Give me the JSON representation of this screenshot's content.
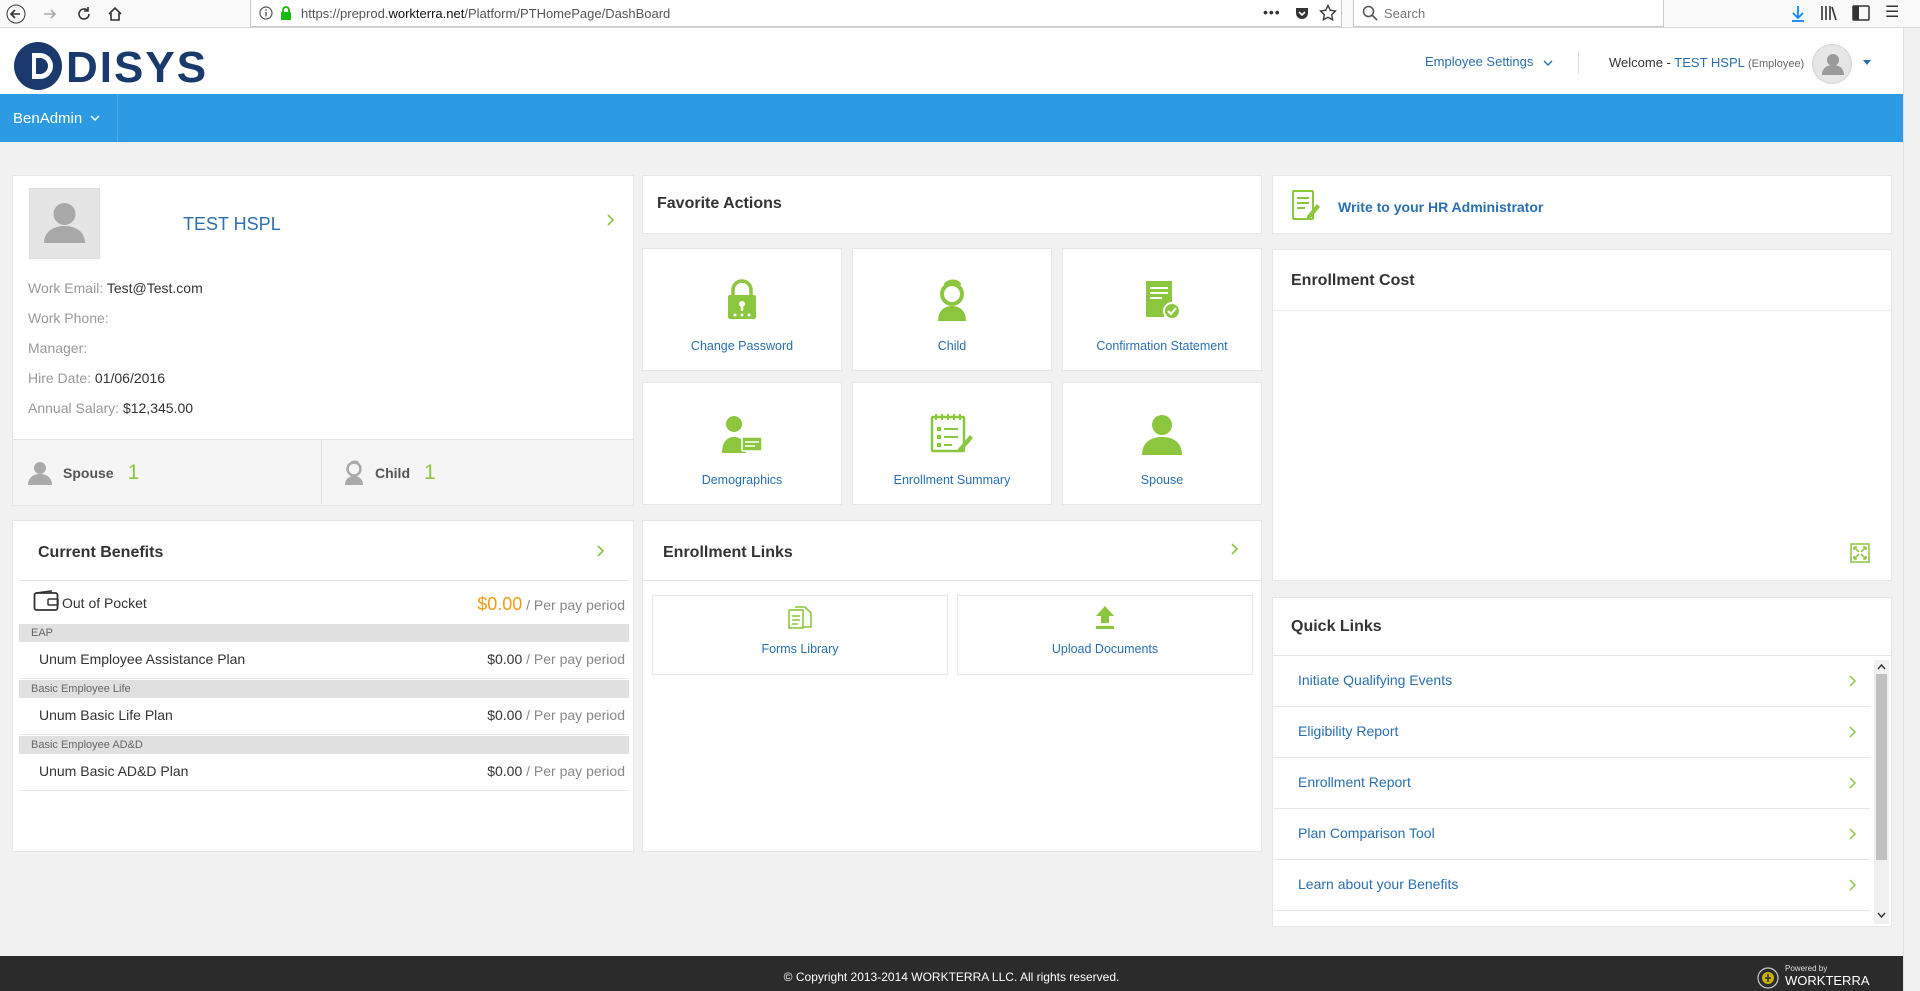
{
  "browser": {
    "url_prefix": "https://preprod.",
    "url_domain": "workterra.net",
    "url_path": "/Platform/PTHomePage/DashBoard",
    "search_placeholder": "Search"
  },
  "header": {
    "logo": "DISYS",
    "employee_settings": "Employee Settings",
    "welcome_label": "Welcome -",
    "user_name": "TEST HSPL",
    "user_role": "(Employee)"
  },
  "nav": {
    "benadmin": "BenAdmin"
  },
  "profile": {
    "name": "TEST HSPL",
    "fields": [
      {
        "label": "Work Email:",
        "value": "Test@Test.com"
      },
      {
        "label": "Work Phone:",
        "value": ""
      },
      {
        "label": "Manager:",
        "value": ""
      },
      {
        "label": "Hire Date:",
        "value": "01/06/2016"
      },
      {
        "label": "Annual Salary:",
        "value": "$12,345.00"
      }
    ],
    "family": [
      {
        "label": "Spouse",
        "count": "1"
      },
      {
        "label": "Child",
        "count": "1"
      }
    ]
  },
  "favorites": {
    "title": "Favorite Actions",
    "tiles": [
      {
        "label": "Change Password",
        "icon": "lock-icon"
      },
      {
        "label": "Child",
        "icon": "child-icon"
      },
      {
        "label": "Confirmation Statement",
        "icon": "certificate-icon"
      },
      {
        "label": "Demographics",
        "icon": "demographics-icon"
      },
      {
        "label": "Enrollment Summary",
        "icon": "checklist-icon"
      },
      {
        "label": "Spouse",
        "icon": "person-icon"
      }
    ]
  },
  "hr": {
    "link": "Write to your HR Administrator"
  },
  "enrollment_cost": {
    "title": "Enrollment Cost"
  },
  "quick_links": {
    "title": "Quick Links",
    "items": [
      "Initiate Qualifying Events",
      "Eligibility Report",
      "Enrollment Report",
      "Plan Comparison Tool",
      "Learn about your Benefits"
    ]
  },
  "benefits": {
    "title": "Current Benefits",
    "out_of_pocket": {
      "label": "Out of Pocket",
      "amount": "$0.00",
      "period": "/ Per pay period"
    },
    "groups": [
      {
        "category": "EAP",
        "plan": "Unum Employee Assistance Plan",
        "amount": "$0.00",
        "period": "/ Per pay period"
      },
      {
        "category": "Basic Employee Life",
        "plan": "Unum Basic Life Plan",
        "amount": "$0.00",
        "period": "/ Per pay period"
      },
      {
        "category": "Basic Employee AD&D",
        "plan": "Unum Basic AD&D Plan",
        "amount": "$0.00",
        "period": "/ Per pay period"
      }
    ]
  },
  "enrollment_links": {
    "title": "Enrollment Links",
    "items": [
      {
        "label": "Forms Library",
        "icon": "document-icon"
      },
      {
        "label": "Upload Documents",
        "icon": "upload-icon"
      }
    ]
  },
  "footer": {
    "copyright": "© Copyright 2013-2014 WORKTERRA LLC. All rights reserved.",
    "powered_by": "Powered by",
    "brand": "WORKTERRA"
  },
  "colors": {
    "accent_blue": "#2d9be4",
    "link_blue": "#2a6fb0",
    "green": "#8cc63f",
    "orange": "#f39c12"
  }
}
